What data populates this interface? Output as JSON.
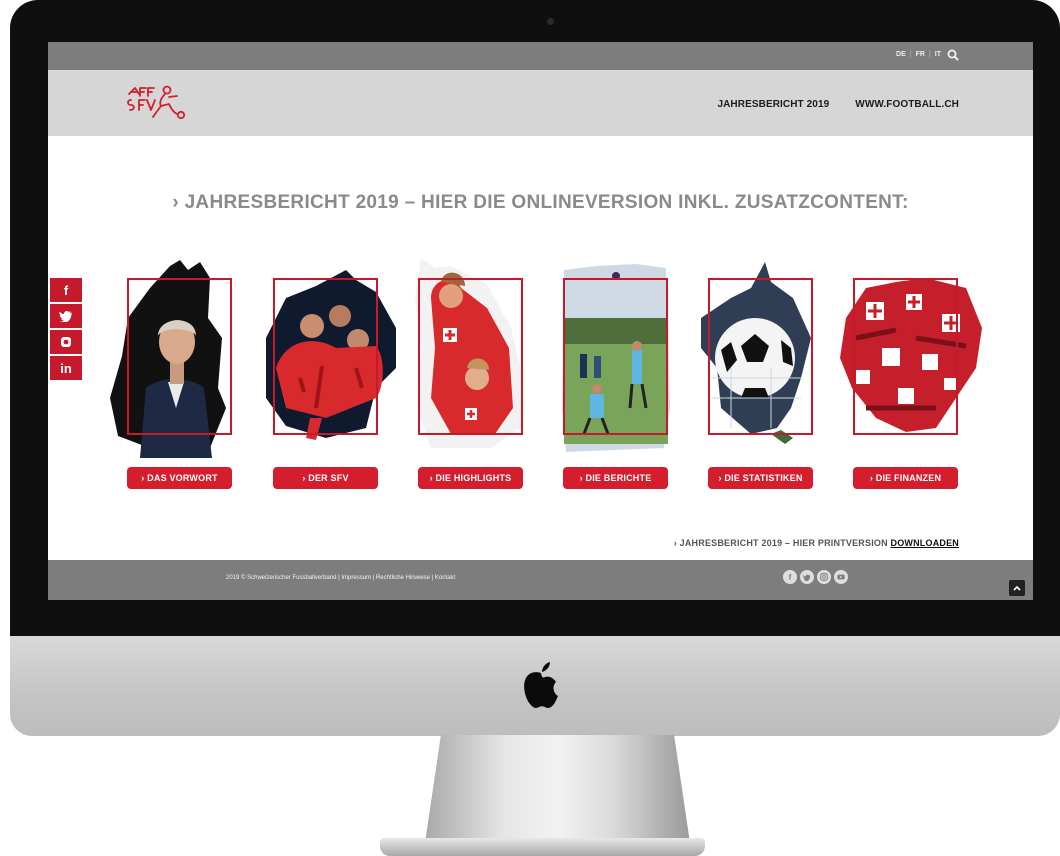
{
  "languages": [
    "DE",
    "FR",
    "IT"
  ],
  "nav": {
    "annual_report": "JAHRESBERICHT 2019",
    "football_site": "WWW.FOOTBALL.CH"
  },
  "headline": "› JAHRESBERICHT 2019 – HIER DIE ONLINEVERSION INKL. ZUSATZCONTENT:",
  "social_sidebar": [
    "facebook-icon",
    "twitter-icon",
    "instagram-icon",
    "linkedin-icon"
  ],
  "cards": [
    {
      "label": "› DAS VORWORT"
    },
    {
      "label": "› DER SFV"
    },
    {
      "label": "› DIE HIGHLIGHTS"
    },
    {
      "label": "› DIE BERICHTE"
    },
    {
      "label": "› DIE STATISTIKEN"
    },
    {
      "label": "› DIE FINANZEN"
    }
  ],
  "print_version": {
    "text": "› JAHRESBERICHT 2019 – HIER PRINTVERSION ",
    "link": "DOWNLOADEN"
  },
  "footer": {
    "copyright": "2019 © Schweizerischer Fussballverband | Impressum | Rechtliche Hinweise | Kontakt",
    "social": [
      "facebook-icon",
      "twitter-icon",
      "instagram-icon",
      "youtube-icon"
    ]
  },
  "colors": {
    "brand_red": "#c41a2b",
    "bar_gray": "#7d7d7d",
    "header_gray": "#d6d6d6"
  }
}
